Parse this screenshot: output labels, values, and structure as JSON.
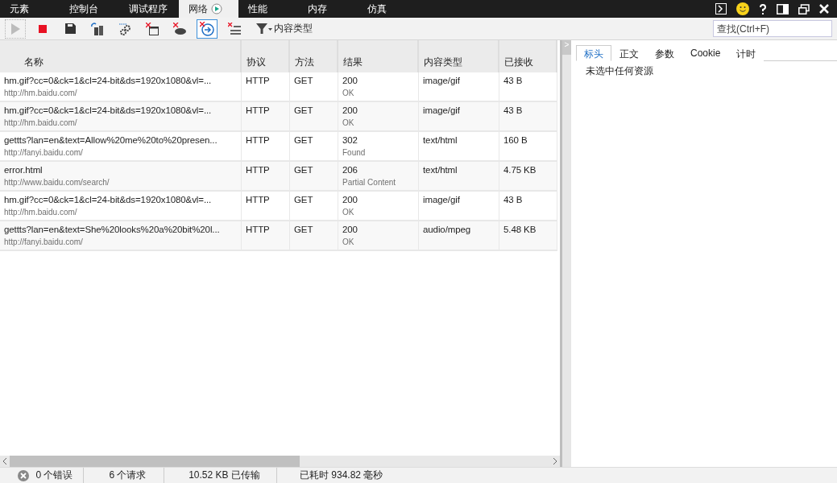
{
  "tabs": [
    {
      "label": "元素",
      "selected": false
    },
    {
      "label": "控制台",
      "selected": false
    },
    {
      "label": "调试程序",
      "selected": false
    },
    {
      "label": "网络",
      "selected": true,
      "recording": true
    },
    {
      "label": "性能",
      "selected": false
    },
    {
      "label": "内存",
      "selected": false
    },
    {
      "label": "仿真",
      "selected": false
    }
  ],
  "toolbar": {
    "tools": [
      {
        "kind": "play",
        "disabled": true,
        "on": false
      },
      {
        "kind": "stop",
        "disabled": false,
        "on": false
      },
      {
        "kind": "save",
        "disabled": false,
        "on": false
      },
      {
        "kind": "refresh",
        "disabled": false,
        "on": false
      },
      {
        "kind": "gears",
        "disabled": false,
        "on": false
      },
      {
        "kind": "clear-window",
        "disabled": false,
        "on": false
      },
      {
        "kind": "clear-cache",
        "disabled": false,
        "on": false
      },
      {
        "kind": "clear-nav",
        "disabled": false,
        "on": true
      },
      {
        "kind": "clear-list",
        "disabled": false,
        "on": false
      }
    ],
    "filter_label": "内容类型",
    "search": {
      "placeholder": "查找(Ctrl+F)"
    }
  },
  "table": {
    "columns": [
      "名称",
      "协议",
      "方法",
      "结果",
      "内容类型",
      "已接收"
    ],
    "rows": [
      {
        "name": "hm.gif?cc=0&ck=1&cl=24-bit&ds=1920x1080&vl=...",
        "host": "http://hm.baidu.com/",
        "protocol": "HTTP",
        "method": "GET",
        "code": "200",
        "status": "OK",
        "type": "image/gif",
        "received": "43 B"
      },
      {
        "name": "hm.gif?cc=0&ck=1&cl=24-bit&ds=1920x1080&vl=...",
        "host": "http://hm.baidu.com/",
        "protocol": "HTTP",
        "method": "GET",
        "code": "200",
        "status": "OK",
        "type": "image/gif",
        "received": "43 B"
      },
      {
        "name": "gettts?lan=en&text=Allow%20me%20to%20presen...",
        "host": "http://fanyi.baidu.com/",
        "protocol": "HTTP",
        "method": "GET",
        "code": "302",
        "status": "Found",
        "type": "text/html",
        "received": "160 B"
      },
      {
        "name": "error.html",
        "host": "http://www.baidu.com/search/",
        "protocol": "HTTP",
        "method": "GET",
        "code": "206",
        "status": "Partial Content",
        "type": "text/html",
        "received": "4.75 KB"
      },
      {
        "name": "hm.gif?cc=0&ck=1&cl=24-bit&ds=1920x1080&vl=...",
        "host": "http://hm.baidu.com/",
        "protocol": "HTTP",
        "method": "GET",
        "code": "200",
        "status": "OK",
        "type": "image/gif",
        "received": "43 B"
      },
      {
        "name": "gettts?lan=en&text=She%20looks%20a%20bit%20l...",
        "host": "http://fanyi.baidu.com/",
        "protocol": "HTTP",
        "method": "GET",
        "code": "200",
        "status": "OK",
        "type": "audio/mpeg",
        "received": "5.48 KB"
      }
    ]
  },
  "details": {
    "tabs": [
      {
        "label": "标头",
        "selected": true
      },
      {
        "label": "正文",
        "selected": false
      },
      {
        "label": "参数",
        "selected": false
      },
      {
        "label": "Cookie",
        "selected": false
      },
      {
        "label": "计时",
        "selected": false
      }
    ],
    "splitter_glyph": ">",
    "message": "未选中任何资源"
  },
  "status_bar": {
    "errors": "0 个错误",
    "requests": "6 个请求",
    "transferred": "10.52 KB 已传输",
    "elapsed": "已耗时 934.82 毫秒"
  }
}
